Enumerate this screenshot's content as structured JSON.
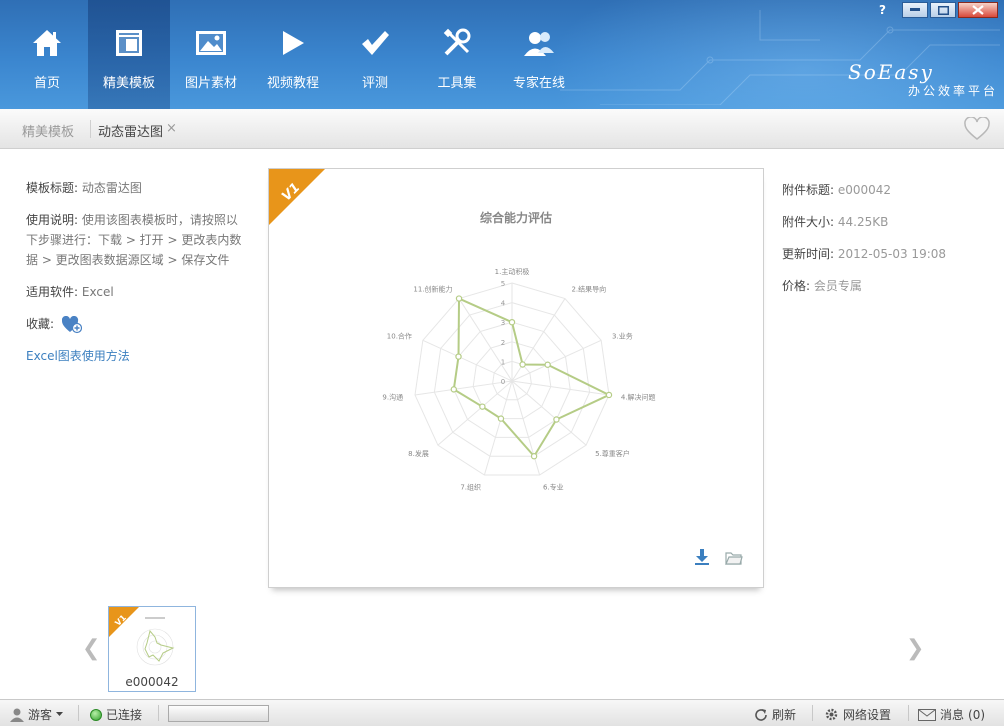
{
  "window": {
    "help": "?",
    "minimize": "-",
    "maximize": "□",
    "close": "×"
  },
  "nav": {
    "items": [
      {
        "label": "首页",
        "icon": "home-icon"
      },
      {
        "label": "精美模板",
        "icon": "template-icon",
        "active": true
      },
      {
        "label": "图片素材",
        "icon": "image-icon"
      },
      {
        "label": "视频教程",
        "icon": "play-icon"
      },
      {
        "label": "评测",
        "icon": "check-icon"
      },
      {
        "label": "工具集",
        "icon": "tools-icon"
      },
      {
        "label": "专家在线",
        "icon": "experts-icon"
      }
    ]
  },
  "brand": {
    "name": "SoEasy",
    "slogan": "办公效率平台"
  },
  "tabs": {
    "parent": "精美模板",
    "current": "动态雷达图",
    "close": "×"
  },
  "template_info": {
    "title_label": "模板标题:",
    "title_value": "动态雷达图",
    "usage_label": "使用说明:",
    "usage_value": "使用该图表模板时，请按照以下步骤进行：下载 > 打开 > 更改表内数据 > 更改图表数据源区域 > 保存文件",
    "software_label": "适用软件:",
    "software_value": "Excel",
    "favorite_label": "收藏:",
    "help_link": "Excel图表使用方法"
  },
  "attachment": {
    "title_label": "附件标题:",
    "title_value": "e000042",
    "size_label": "附件大小:",
    "size_value": "44.25KB",
    "updated_label": "更新时间:",
    "updated_value": "2012-05-03 19:08",
    "price_label": "价格:",
    "price_value": "会员专属"
  },
  "preview": {
    "badge": "V1"
  },
  "chart_data": {
    "type": "radar",
    "title": "综合能力评估",
    "categories": [
      "1.主动积极",
      "2.结果导向",
      "3.业务",
      "4.解决问题",
      "5.尊重客户",
      "6.专业",
      "7.组织",
      "8.发展",
      "9.沟通",
      "10.合作",
      "11.创新能力"
    ],
    "values": [
      3,
      1,
      2,
      5,
      3,
      4,
      2,
      2,
      3,
      3,
      5
    ],
    "ticks": [
      "0",
      "1",
      "2",
      "3",
      "4",
      "5"
    ],
    "rmax": 5,
    "series_color": "#b5cc86",
    "grid": true
  },
  "thumbnails": [
    {
      "code": "e000042",
      "badge": "V1"
    }
  ],
  "status": {
    "user": "游客",
    "connection": "已连接",
    "refresh": "刷新",
    "network": "网络设置",
    "messages": "消息",
    "messages_count": "(0)"
  },
  "colors": {
    "header": "#3b86cf",
    "accent": "#3b7fbf",
    "ribbon": "#e8951a"
  }
}
